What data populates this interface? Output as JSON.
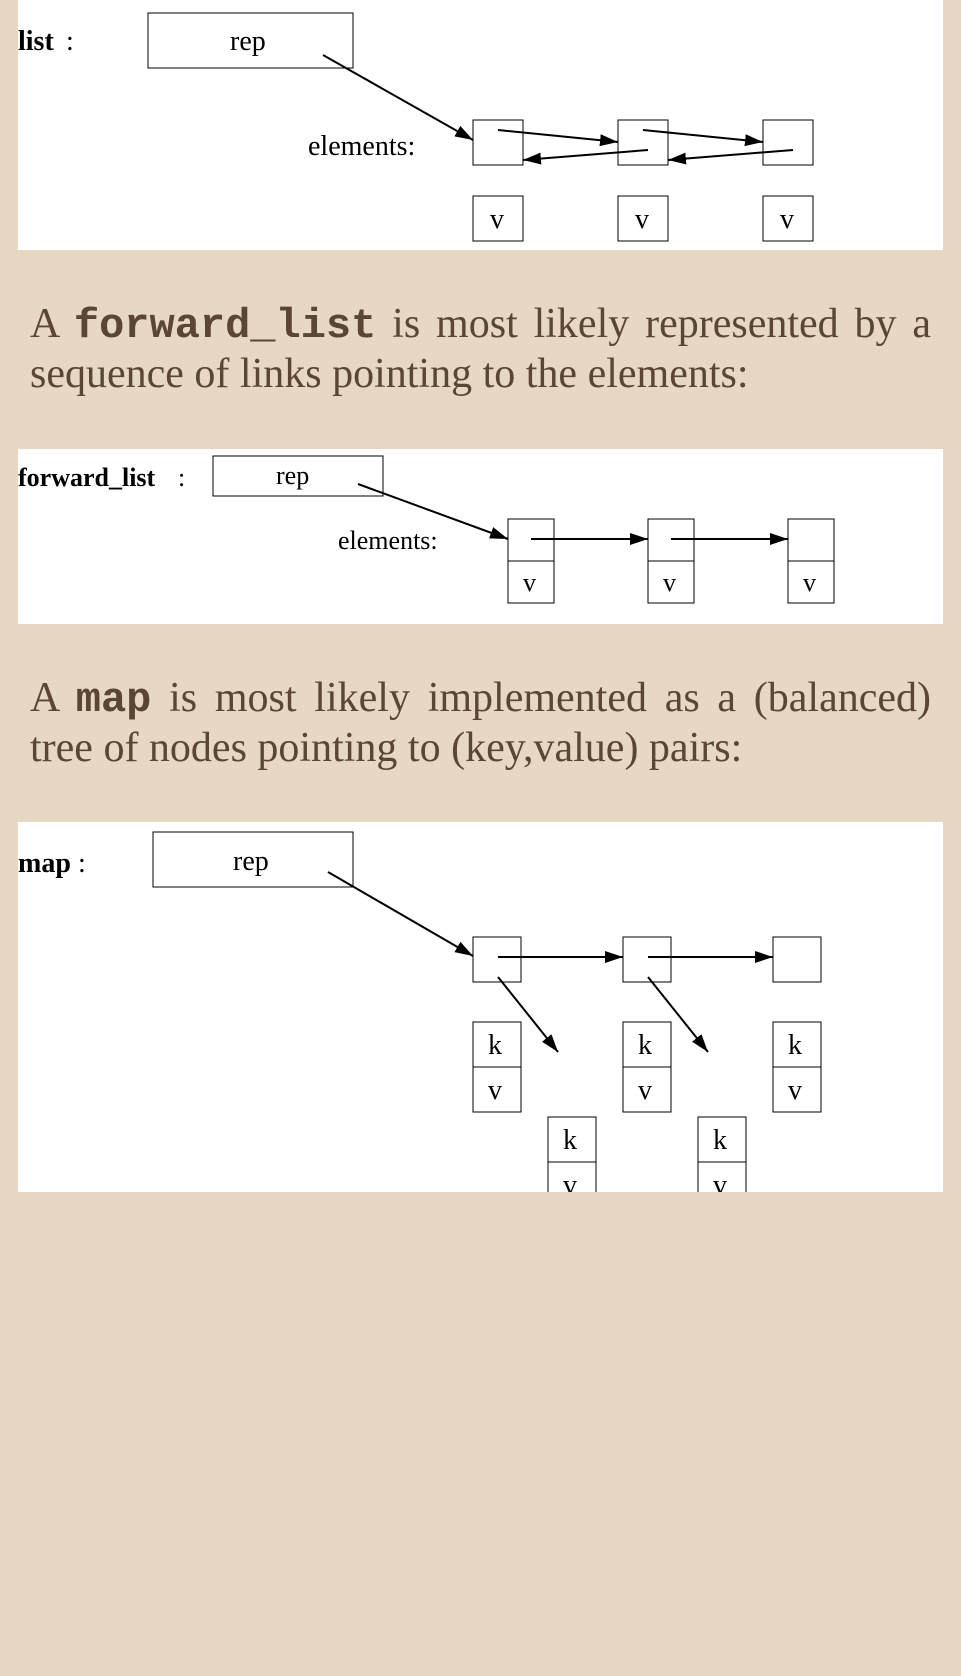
{
  "figures": {
    "list": {
      "label": "list",
      "rep": "rep",
      "elements_label": "elements:",
      "node_label": "v"
    },
    "forward_list": {
      "label": "forward_list",
      "rep": "rep",
      "elements_label": "elements:",
      "node_label": "v"
    },
    "map": {
      "label": "map",
      "rep": "rep",
      "node_k": "k",
      "node_v": "v"
    }
  },
  "paragraphs": {
    "p1_pre": "A ",
    "p1_code": "forward_list",
    "p1_post": " is most likely rep­resented by a sequence of links poin­ting to the elements:",
    "p2_pre": "A ",
    "p2_code": "map",
    "p2_post": " is most likely implemented as a (balanced) tree of nodes pointing to (key,value) pairs:"
  }
}
